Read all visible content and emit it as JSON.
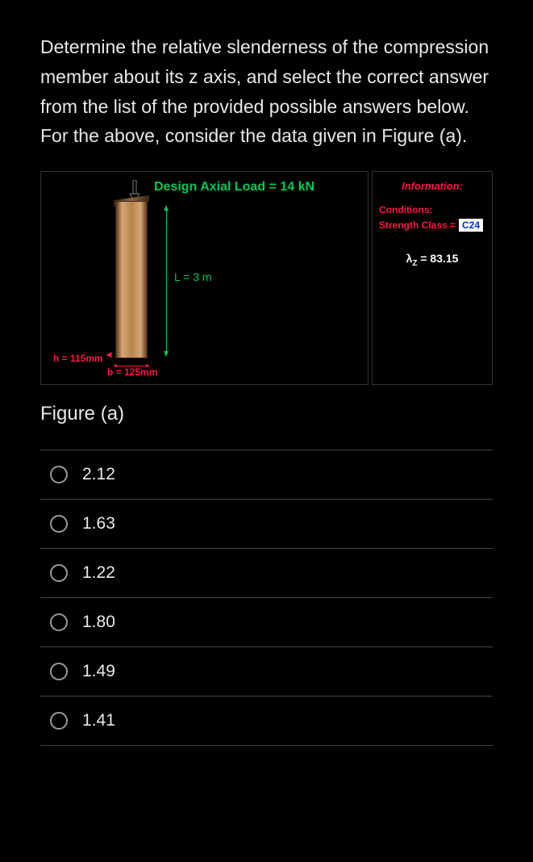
{
  "question": "Determine the relative slenderness of the compression member about its z axis, and select the correct answer from the list of the provided possible answers below. For the above, consider the data given in Figure (a).",
  "figure": {
    "axial_load": "Design Axial Load = 14 kN",
    "length": "L = 3 m",
    "h": "h = 115mm",
    "b": "b = 125mm",
    "caption": "Figure (a)"
  },
  "info": {
    "title": "Information:",
    "conditions_label": "Conditions:",
    "strength_label": "Strength Class =",
    "strength_value": "C24",
    "lambda_symbol": "λ",
    "lambda_sub": "Z",
    "lambda_value": " = 83.15"
  },
  "options": [
    "2.12",
    "1.63",
    "1.22",
    "1.80",
    "1.49",
    "1.41"
  ]
}
